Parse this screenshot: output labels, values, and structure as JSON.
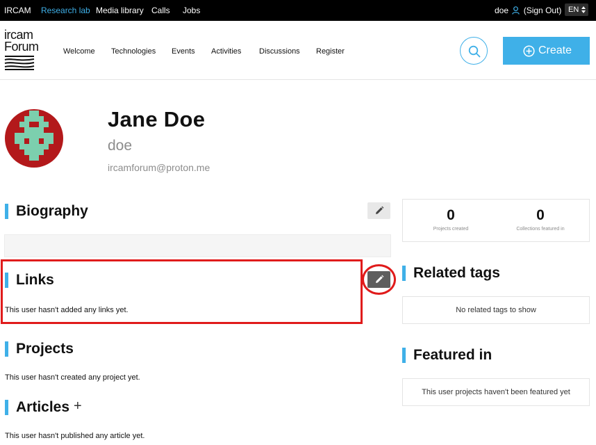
{
  "topbar": {
    "links": [
      "IRCAM",
      "Research lab",
      "Media library",
      "Calls",
      "Jobs"
    ],
    "active": "Research lab",
    "username": "doe",
    "sign_out": "(Sign Out)",
    "language": "EN"
  },
  "header": {
    "logo_line1": "ircam",
    "logo_line2": "Forum",
    "nav": [
      "Welcome",
      "Technologies",
      "Events",
      "Activities",
      "Discussions",
      "Register"
    ],
    "create_label": "Create"
  },
  "profile": {
    "full_name": "Jane Doe",
    "username": "doe",
    "email": "ircamforum@proton.me"
  },
  "sections": {
    "biography": {
      "title": "Biography"
    },
    "links": {
      "title": "Links",
      "empty": "This user hasn't added any links yet."
    },
    "projects": {
      "title": "Projects",
      "empty": "This user hasn't created any project yet."
    },
    "articles": {
      "title": "Articles",
      "add": "+",
      "empty": "This user hasn't published any article yet."
    }
  },
  "sidebar": {
    "stats": [
      {
        "value": "0",
        "label": "Projects created"
      },
      {
        "value": "0",
        "label": "Collections featured in"
      }
    ],
    "related_tags": {
      "title": "Related tags",
      "empty": "No related tags to show"
    },
    "featured_in": {
      "title": "Featured in",
      "empty": "This user projects haven't been featured yet"
    }
  },
  "colors": {
    "accent": "#3fb0e8",
    "highlight": "#e01b1b",
    "avatar_bg": "#b3191b",
    "avatar_fg": "#7ccfae"
  }
}
